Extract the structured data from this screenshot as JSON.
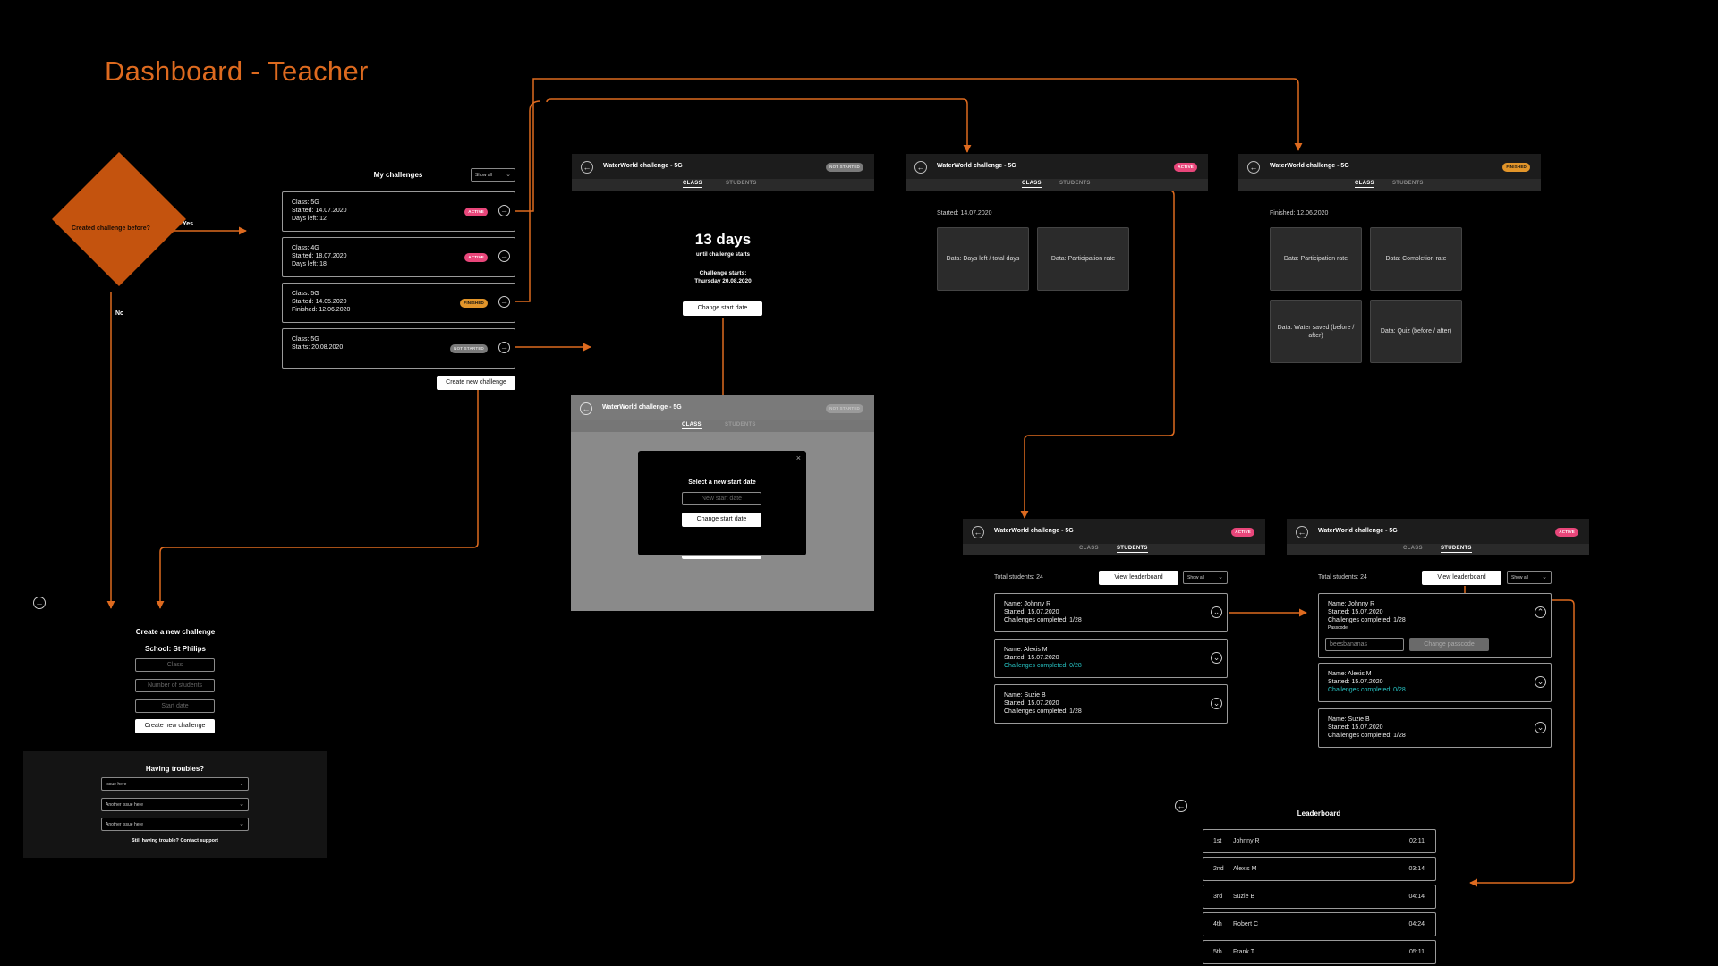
{
  "title": "Dashboard - Teacher",
  "colors": {
    "accent": "#dd6a1f",
    "active": "#e8467a",
    "finished": "#e2952a",
    "not_started": "#7a7a7a",
    "teal": "#27c7c7"
  },
  "decision": {
    "question": "Created challenge before?",
    "yes": "Yes",
    "no": "No"
  },
  "my_challenges": {
    "heading": "My challenges",
    "filter": "Show all",
    "items": [
      {
        "lines": [
          "Class: 5G",
          "Started: 14.07.2020",
          "Days left: 12"
        ],
        "status": "ACTIVE",
        "icon": "arrow-right-circle-icon"
      },
      {
        "lines": [
          "Class: 4G",
          "Started: 18.07.2020",
          "Days left: 18"
        ],
        "status": "ACTIVE",
        "icon": "arrow-right-circle-icon"
      },
      {
        "lines": [
          "Class: 5G",
          "Started: 14.05.2020",
          "Finished: 12.06.2020"
        ],
        "status": "FINISHED",
        "icon": "arrow-right-circle-icon"
      },
      {
        "lines": [
          "Class: 5G",
          "Starts: 20.08.2020"
        ],
        "status": "NOT STARTED",
        "icon": "arrow-right-circle-icon"
      }
    ],
    "create_button": "Create new challenge"
  },
  "screen_not_started": {
    "title": "WaterWorld challenge - 5G",
    "status": "NOT STARTED",
    "tabs": [
      "CLASS",
      "STUDENTS"
    ],
    "days": "13 days",
    "until": "until challenge starts",
    "starts_label": "Challenge starts:",
    "starts_date": "Thursday 20.08.2020",
    "button": "Change start date"
  },
  "modal_screen": {
    "title": "WaterWorld challenge - 5G",
    "status": "NOT STARTED",
    "tabs": [
      "CLASS",
      "STUDENTS"
    ],
    "modal_title": "Select a new start date",
    "input_placeholder": "New start date",
    "button": "Change start date",
    "close": "×"
  },
  "screen_active": {
    "title": "WaterWorld challenge - 5G",
    "status": "ACTIVE",
    "tabs": [
      "CLASS",
      "STUDENTS"
    ],
    "started": "Started: 14.07.2020",
    "tiles": [
      "Data: Days left / total days",
      "Data: Participation rate"
    ]
  },
  "screen_finished": {
    "title": "WaterWorld challenge - 5G",
    "status": "FINISHED",
    "tabs": [
      "CLASS",
      "STUDENTS"
    ],
    "finished": "Finished: 12.06.2020",
    "tiles": [
      "Data: Participation rate",
      "Data: Completion rate",
      "Data: Water saved (before / after)",
      "Data: Quiz (before / after)"
    ]
  },
  "students_a": {
    "title": "WaterWorld challenge - 5G",
    "status": "ACTIVE",
    "tabs": [
      "CLASS",
      "STUDENTS"
    ],
    "total": "Total students: 24",
    "leaderboard_button": "View leaderboard",
    "filter": "Show all",
    "students": [
      {
        "name": "Name: Johnny R",
        "started": "Started: 15.07.2020",
        "completed": "Challenges completed: 1/28",
        "teal": false
      },
      {
        "name": "Name: Alexis M",
        "started": "Started: 15.07.2020",
        "completed": "Challenges completed: 0/28",
        "teal": true
      },
      {
        "name": "Name: Suzie B",
        "started": "Started: 15.07.2020",
        "completed": "Challenges completed: 1/28",
        "teal": false
      }
    ]
  },
  "students_b": {
    "title": "WaterWorld challenge - 5G",
    "status": "ACTIVE",
    "tabs": [
      "CLASS",
      "STUDENTS"
    ],
    "total": "Total students: 24",
    "leaderboard_button": "View leaderboard",
    "filter": "Show all",
    "passcode_label": "Passcode",
    "passcode_value": "beesbananas",
    "passcode_button": "Change passcode",
    "students": [
      {
        "name": "Name: Johnny R",
        "started": "Started: 15.07.2020",
        "completed": "Challenges completed: 1/28",
        "teal": false
      },
      {
        "name": "Name: Alexis M",
        "started": "Started: 15.07.2020",
        "completed": "Challenges completed: 0/28",
        "teal": true
      },
      {
        "name": "Name: Suzie B",
        "started": "Started: 15.07.2020",
        "completed": "Challenges completed: 1/28",
        "teal": false
      }
    ]
  },
  "create_form": {
    "heading": "Create a new challenge",
    "school": "School: St Philips",
    "fields": [
      "Class",
      "Number of students",
      "Start date"
    ],
    "button": "Create new challenge"
  },
  "troubles": {
    "heading": "Having troubles?",
    "issues": [
      "Issue here",
      "Another issue here",
      "Another issue here"
    ],
    "footer_text": "Still having trouble?",
    "footer_link": "Contact support"
  },
  "leaderboard": {
    "heading": "Leaderboard",
    "rows": [
      {
        "rank": "1st",
        "name": "Johnny R",
        "time": "02:11"
      },
      {
        "rank": "2nd",
        "name": "Alexis M",
        "time": "03:14"
      },
      {
        "rank": "3rd",
        "name": "Suzie B",
        "time": "04:14"
      },
      {
        "rank": "4th",
        "name": "Robert C",
        "time": "04:24"
      },
      {
        "rank": "5th",
        "name": "Frank T",
        "time": "05:11"
      }
    ]
  }
}
